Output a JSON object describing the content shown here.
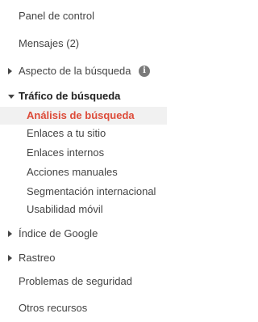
{
  "nav": {
    "panel_control": "Panel de control",
    "mensajes": "Mensajes (2)",
    "aspecto_busqueda": "Aspecto de la búsqueda",
    "info_icon": "i",
    "trafico_busqueda": "Tráfico de búsqueda",
    "sub": {
      "analisis_busqueda": "Análisis de búsqueda",
      "enlaces_sitio": "Enlaces a tu sitio",
      "enlaces_internos": "Enlaces internos",
      "acciones_manuales": "Acciones manuales",
      "segmentacion_internacional": "Segmentación internacional",
      "usabilidad_movil": "Usabilidad móvil"
    },
    "indice_google": "Índice de Google",
    "rastreo": "Rastreo",
    "problemas_seguridad": "Problemas de seguridad",
    "otros_recursos": "Otros recursos"
  },
  "colors": {
    "active_text": "#dd4b39",
    "active_bg": "#f1f1f1",
    "text": "#444444"
  }
}
